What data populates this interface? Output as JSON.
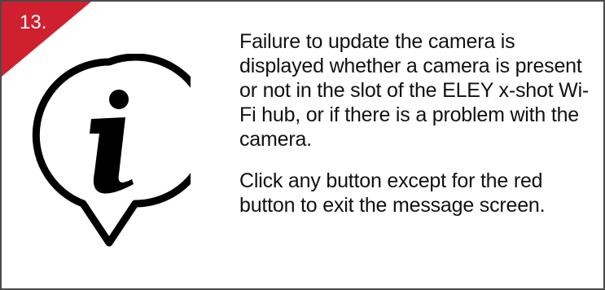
{
  "card": {
    "step_number": "13.",
    "icon": "info-speech-bubble-icon",
    "paragraphs": [
      "Failure to update the camera is displayed whether a camera is present or not in the slot of the ELEY x-shot Wi-Fi hub, or if there is a problem with the camera.",
      "Click any button except for the red button to exit the message screen."
    ]
  },
  "colors": {
    "accent_red": "#d0202f",
    "border": "#4a4a4a",
    "text": "#111111"
  }
}
